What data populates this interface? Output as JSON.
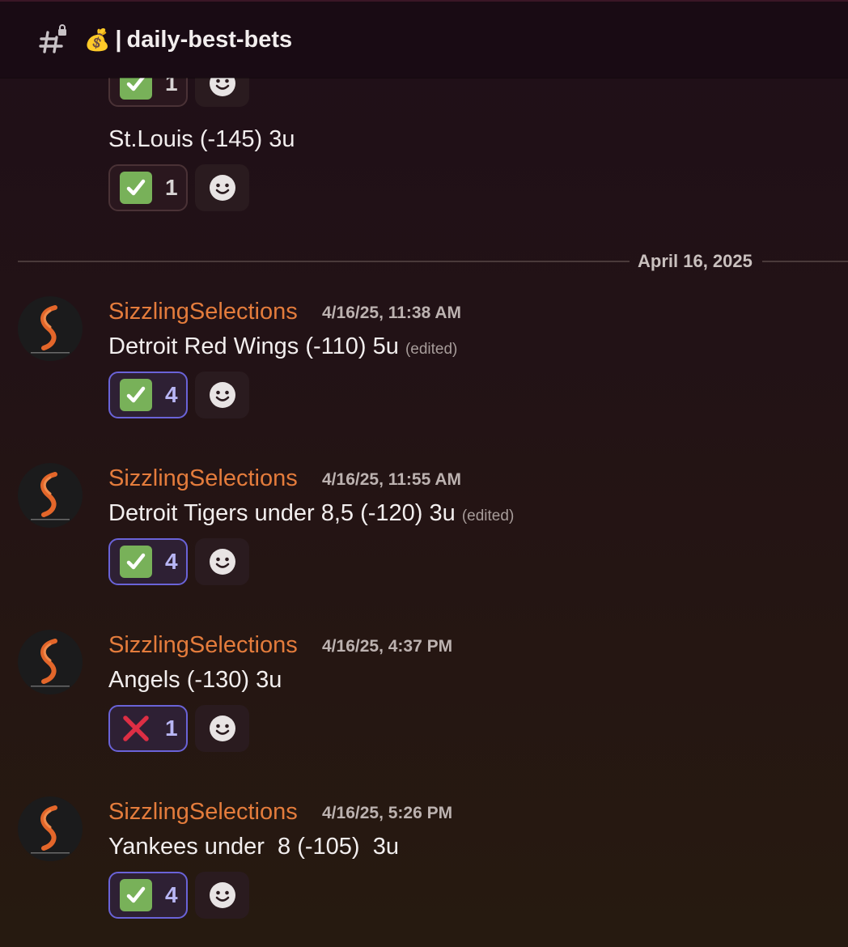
{
  "channel": {
    "name": "daily-best-bets",
    "emoji": "💰",
    "separator": "|",
    "icon": "locked-hash-icon"
  },
  "top_messages": [
    {
      "text": "",
      "reaction": {
        "emoji": "check-mark-icon",
        "count": "1",
        "active": false
      }
    },
    {
      "text": "St.Louis (-145) 3u",
      "reaction": {
        "emoji": "check-mark-icon",
        "count": "1",
        "active": false
      }
    }
  ],
  "date_divider": "April 16, 2025",
  "messages": [
    {
      "author": "SizzlingSelections",
      "timestamp": "4/16/25, 11:38 AM",
      "text": "Detroit Red Wings (-110) 5u",
      "edited": "(edited)",
      "reaction": {
        "emoji": "check-mark-icon",
        "count": "4",
        "active": true
      }
    },
    {
      "author": "SizzlingSelections",
      "timestamp": "4/16/25, 11:55 AM",
      "text": "Detroit Tigers under 8,5 (-120) 3u",
      "edited": "(edited)",
      "reaction": {
        "emoji": "check-mark-icon",
        "count": "4",
        "active": true
      }
    },
    {
      "author": "SizzlingSelections",
      "timestamp": "4/16/25, 4:37 PM",
      "text": "Angels (-130) 3u",
      "edited": "",
      "reaction": {
        "emoji": "cross-mark-icon",
        "count": "1",
        "active": true
      }
    },
    {
      "author": "SizzlingSelections",
      "timestamp": "4/16/25, 5:26 PM",
      "text": "Yankees under  8 (-105)  3u",
      "edited": "",
      "reaction": {
        "emoji": "check-mark-icon",
        "count": "4",
        "active": true
      }
    }
  ],
  "colors": {
    "username": "#e47c3c",
    "active_border": "#6a63d8",
    "check_green": "#78b159",
    "cross_red": "#dd2e44"
  }
}
